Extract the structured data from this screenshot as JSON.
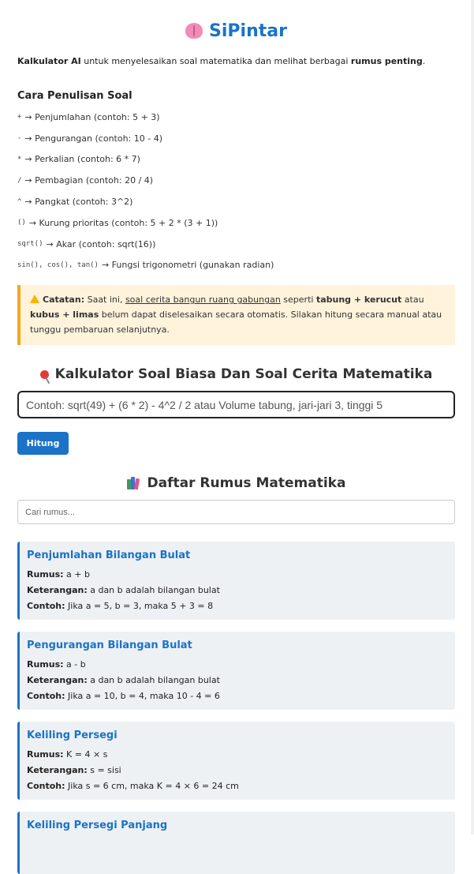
{
  "app": {
    "title": "SiPintar"
  },
  "intro": {
    "strong1": "Kalkulator AI",
    "text1": " untuk menyelesaikan soal matematika dan melihat berbagai ",
    "strong2": "rumus penting",
    "text2": "."
  },
  "guide": {
    "heading": "Cara Penulisan Soal",
    "rules": [
      {
        "code": "+",
        "desc": "→ Penjumlahan (contoh: 5 + 3)"
      },
      {
        "code": "-",
        "desc": "→ Pengurangan (contoh: 10 - 4)"
      },
      {
        "code": "*",
        "desc": "→ Perkalian (contoh: 6 * 7)"
      },
      {
        "code": "/",
        "desc": "→ Pembagian (contoh: 20 / 4)"
      },
      {
        "code": "^",
        "desc": "→ Pangkat (contoh: 3^2)"
      },
      {
        "code": "()",
        "desc": "→ Kurung prioritas (contoh: 5 + 2 * (3 + 1))"
      },
      {
        "code": "sqrt()",
        "desc": "→ Akar (contoh: sqrt(16))"
      },
      {
        "code": "sin(), cos(), tan()",
        "desc": "→ Fungsi trigonometri (gunakan radian)"
      }
    ]
  },
  "note": {
    "label": "Catatan:",
    "t1": " Saat ini, ",
    "link": "soal cerita bangun ruang gabungan",
    "t2": " seperti ",
    "b1": "tabung + kerucut",
    "t3": " atau ",
    "b2": "kubus + limas",
    "t4": " belum dapat diselesaikan secara otomatis. Silakan hitung secara manual atau tunggu pembaruan selanjutnya."
  },
  "calculator": {
    "heading": "Kalkulator Soal Biasa Dan Soal Cerita Matematika",
    "placeholder": "Contoh: sqrt(49) + (6 * 2) - 4^2 / 2 atau Volume tabung, jari-jari 3, tinggi 5",
    "button": "Hitung"
  },
  "formulas": {
    "heading": "Daftar Rumus Matematika",
    "search_placeholder": "Cari rumus...",
    "label_rumus": "Rumus:",
    "label_keterangan": "Keterangan:",
    "label_contoh": "Contoh:",
    "items": [
      {
        "title": "Penjumlahan Bilangan Bulat",
        "rumus": "a + b",
        "keterangan": "a dan b adalah bilangan bulat",
        "contoh": "Jika a = 5, b = 3, maka 5 + 3 = 8"
      },
      {
        "title": "Pengurangan Bilangan Bulat",
        "rumus": "a - b",
        "keterangan": "a dan b adalah bilangan bulat",
        "contoh": "Jika a = 10, b = 4, maka 10 - 4 = 6"
      },
      {
        "title": "Keliling Persegi",
        "rumus": "K = 4 × s",
        "keterangan": "s = sisi",
        "contoh": "Jika s = 6 cm, maka K = 4 × 6 = 24 cm"
      },
      {
        "title": "Keliling Persegi Panjang"
      }
    ]
  }
}
